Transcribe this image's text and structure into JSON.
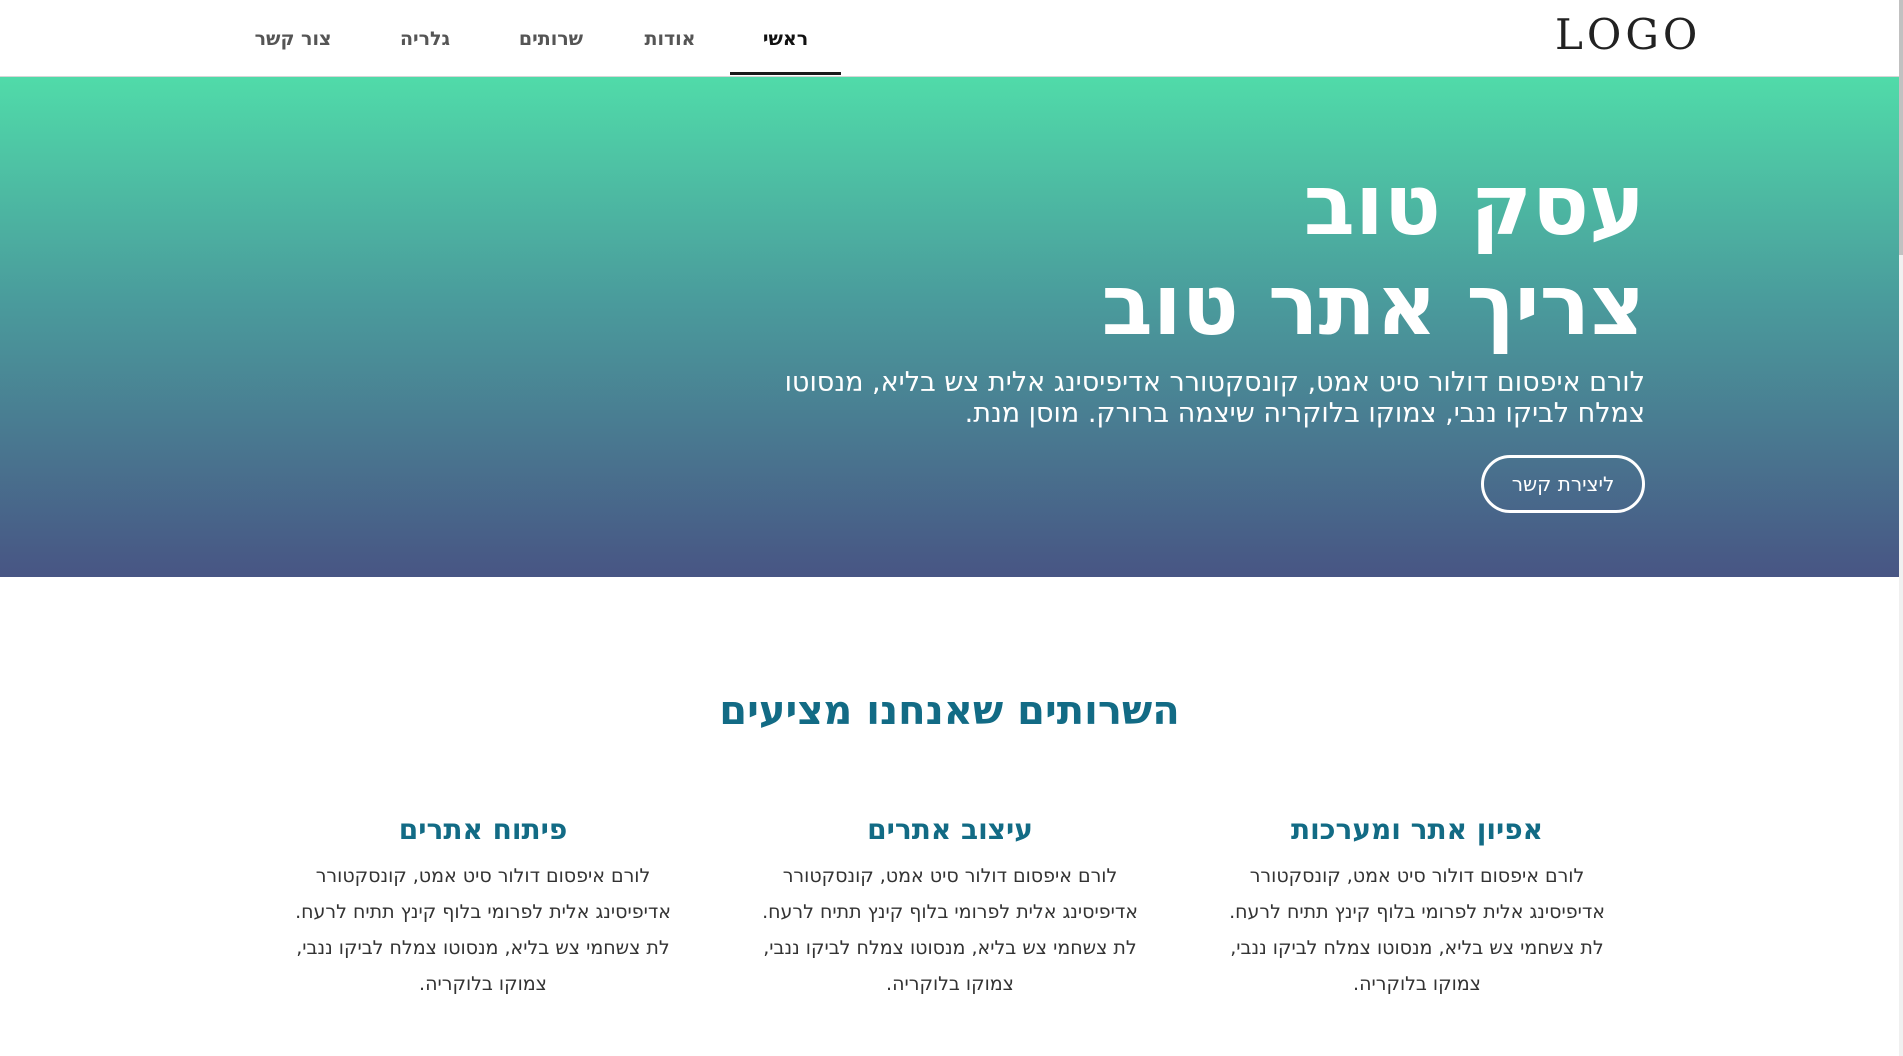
{
  "header": {
    "logo_text": "LOGO",
    "nav": [
      {
        "label": "ראשי",
        "active": true
      },
      {
        "label": "אודות",
        "active": false
      },
      {
        "label": "שרותים",
        "active": false
      },
      {
        "label": "גלריה",
        "active": false
      },
      {
        "label": "צור קשר",
        "active": false
      }
    ]
  },
  "hero": {
    "title_line1": "עסק טוב",
    "title_line2": "צריך אתר טוב",
    "text": "לורם איפסום דולור סיט אמט, קונסקטורר אדיפיסינג אלית צש בליא, מנסוטו צמלח לביקו ננבי, צמוקו בלוקריה שיצמה ברורק. מוסן מנת.",
    "button_label": "ליצירת קשר"
  },
  "services": {
    "title": "השרותים שאנחנו מציעים",
    "items": [
      {
        "title": "אפיון אתר ומערכות",
        "text": "לורם איפסום דולור סיט אמט, קונסקטורר אדיפיסינג אלית לפרומי בלוף קינץ תתיח לרעח. לת צשחמי צש בליא, מנסוטו צמלח לביקו ננבי, צמוקו בלוקריה."
      },
      {
        "title": "עיצוב אתרים",
        "text": "לורם איפסום דולור סיט אמט, קונסקטורר אדיפיסינג אלית לפרומי בלוף קינץ תתיח לרעח. לת צשחמי צש בליא, מנסוטו צמלח לביקו ננבי, צמוקו בלוקריה."
      },
      {
        "title": "פיתוח אתרים",
        "text": "לורם איפסום דולור סיט אמט, קונסקטורר אדיפיסינג אלית לפרומי בלוף קינץ תתיח לרעח. לת צשחמי צש בליא, מנסוטו צמלח לביקו ננבי, צמוקו בלוקריה."
      }
    ]
  },
  "colors": {
    "hero_gradient_top": "#50dba9",
    "hero_gradient_bottom": "#485584",
    "accent_text": "#126b85"
  }
}
